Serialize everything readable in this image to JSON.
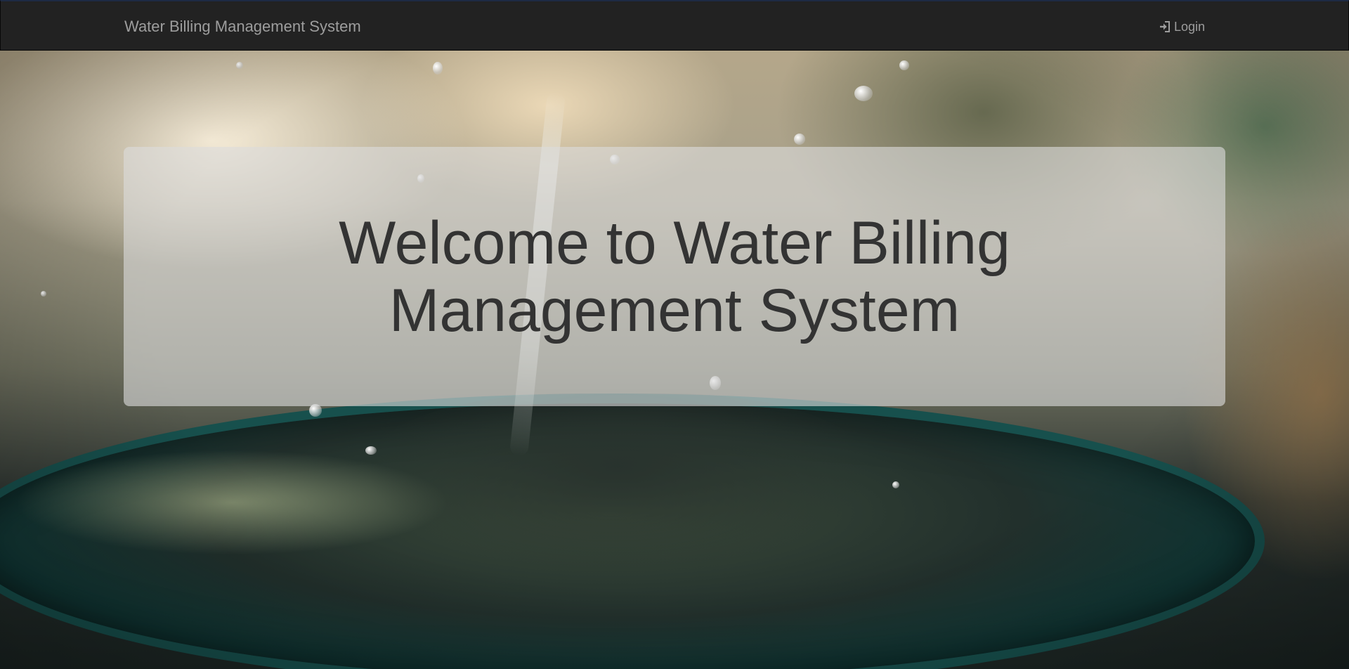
{
  "navbar": {
    "brand": "Water Billing Management System",
    "login_label": "Login",
    "login_icon": "log-in-icon"
  },
  "hero": {
    "heading": "Welcome to Water Billing Management System",
    "background": "water-splash-photo"
  },
  "colors": {
    "navbar_bg": "#222222",
    "navbar_text": "#9d9d9d",
    "heading_text": "#333333",
    "jumbotron_bg": "rgba(220,220,220,0.62)"
  }
}
